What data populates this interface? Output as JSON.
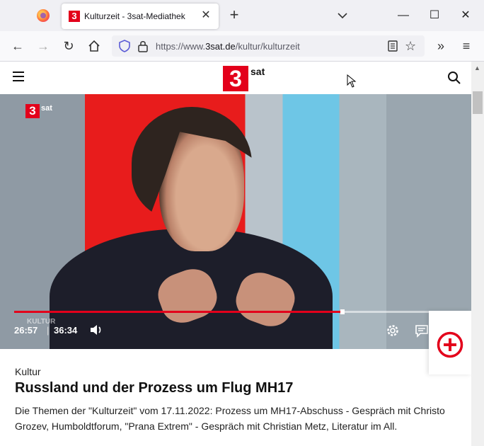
{
  "browser": {
    "tab_title": "Kulturzeit - 3sat-Mediathek",
    "tab_favicon": "3",
    "url_prefix": "https://www.",
    "url_domain": "3sat.de",
    "url_path": "/kultur/kulturzeit",
    "icons": [
      "firefox-icon",
      "close-icon",
      "plus-icon",
      "chevron-down-icon",
      "minimize-icon",
      "maximize-icon",
      "back-icon",
      "forward-icon",
      "reload-icon",
      "home-icon",
      "shield-icon",
      "lock-icon",
      "reader-icon",
      "star-icon",
      "overflow-icon",
      "menu-icon"
    ]
  },
  "site": {
    "logo_number": "3",
    "logo_text": "sat",
    "icons": [
      "hamburger-icon",
      "search-icon"
    ]
  },
  "player": {
    "overlay_logo_number": "3",
    "overlay_logo_text": "sat",
    "overlay_kultur": "KULTUR",
    "current_time": "26:57",
    "separator": "|",
    "total_time": "36:34",
    "progress": 0.737,
    "accent": "#e3001b",
    "icons": [
      "volume-icon",
      "gear-icon",
      "subtitles-icon",
      "add-circle-icon"
    ]
  },
  "article": {
    "category": "Kultur",
    "title": "Russland und der Prozess um Flug MH17",
    "description": "Die Themen der \"Kulturzeit\" vom 17.11.2022: Prozess um MH17-Abschuss - Gespräch mit Christo Grozev, Humboldtforum, \"Prana Extrem\" - Gespräch mit Christian Metz, Literatur im All."
  }
}
